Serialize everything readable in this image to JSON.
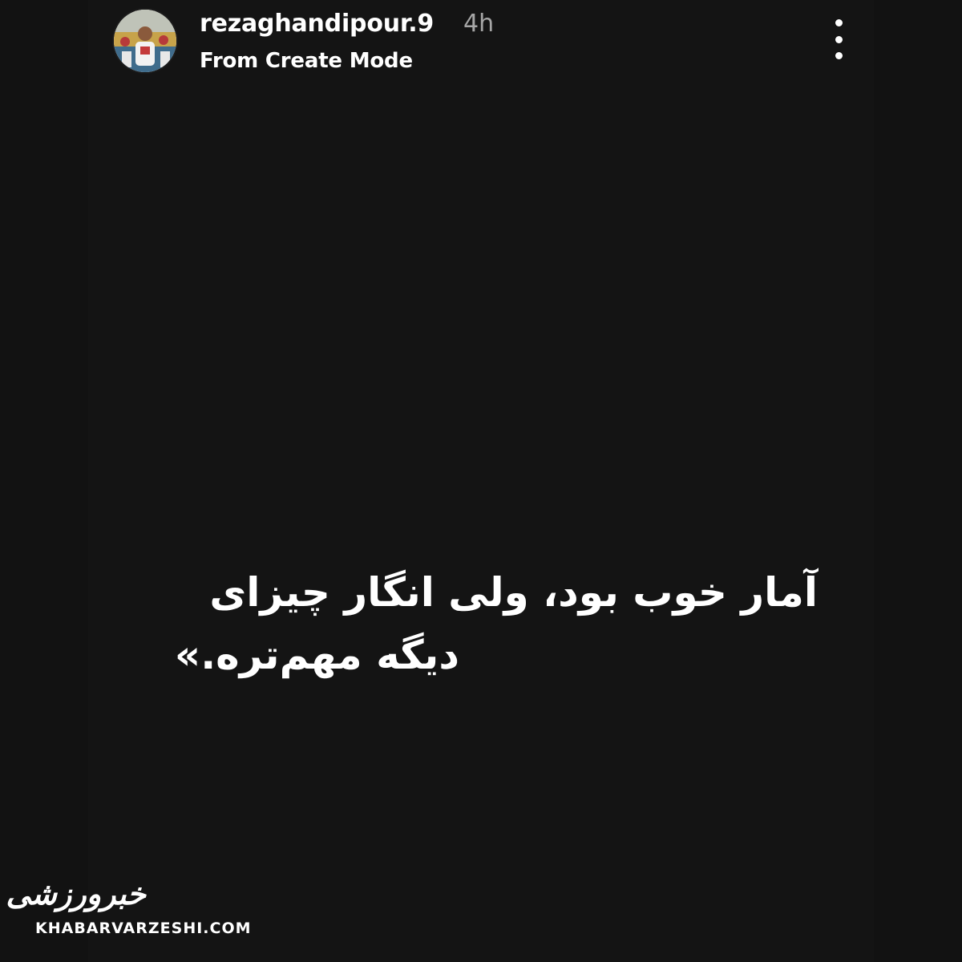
{
  "story_header": {
    "username": "rezaghandipour.9",
    "time": "4h",
    "subtitle": "From Create Mode",
    "avatar_icon": "profile-photo",
    "more_icon": "more-vertical-icon"
  },
  "story_text": {
    "line1": "آمار خوب بود، ولی انگار چیزای",
    "line2": "دیگه مهم‌تره.»"
  },
  "watermark": {
    "logo_text": "خبرورزشی",
    "domain": "KHABARVARZESHI.COM"
  },
  "colors": {
    "background": "#141414",
    "text": "#ffffff",
    "muted_text": "#a6a6a6"
  }
}
